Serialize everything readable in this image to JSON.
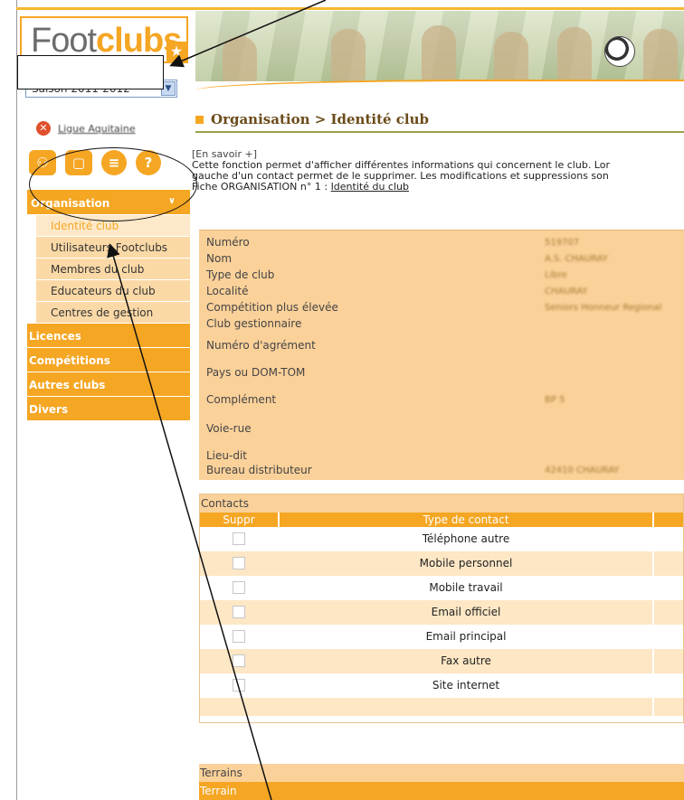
{
  "brand": {
    "foot": "Foot",
    "clubs": "clubs",
    "star_icon": "star-icon"
  },
  "season": {
    "selected": "Saison 2011-2012"
  },
  "logout": {
    "label": "Ligue Aquitaine"
  },
  "tool_icons": [
    "people-icon",
    "document-icon",
    "list-icon",
    "help-icon"
  ],
  "nav": {
    "organisation": "Organisation",
    "sub_items": [
      "Identité club",
      "Utilisateurs Footclubs",
      "Membres du club",
      "Educateurs du club",
      "Centres de gestion"
    ],
    "active_index": 0,
    "main_items": [
      "Licences",
      "Compétitions",
      "Autres clubs",
      "Divers"
    ]
  },
  "page": {
    "title": "Organisation > Identité club",
    "en_savoir": "[En savoir +]",
    "line1": "Cette fonction permet d'afficher différentes informations qui concernent le club. Lor",
    "line2": "gauche d'un contact permet de le supprimer. Les modifications et suppressions son",
    "line3_prefix": "Fiche ORGANISATION n° 1 : ",
    "line3_link": "Identité du club"
  },
  "identity": {
    "rows": [
      {
        "label": "Numéro",
        "value": "519707"
      },
      {
        "label": "Nom",
        "value": "A.S. CHAURAY"
      },
      {
        "label": "Type de club",
        "value": "Libre"
      },
      {
        "label": "Localité",
        "value": "CHAURAY"
      },
      {
        "label": "Compétition plus élevée",
        "value": "Seniors Honneur Regional"
      },
      {
        "label": "Club gestionnaire",
        "value": ""
      },
      {
        "label": "Numéro d'agrément",
        "value": ""
      },
      {
        "label": "Pays ou DOM-TOM",
        "value": ""
      },
      {
        "label": "Complément",
        "value": "BP 5"
      },
      {
        "label": "Voie-rue",
        "value": ""
      },
      {
        "label": "Lieu-dit",
        "value": ""
      },
      {
        "label": "Bureau distributeur",
        "value": "42410 CHAURAY"
      }
    ]
  },
  "contacts": {
    "header": "Contacts",
    "col_suppr": "Suppr",
    "col_type": "Type de contact",
    "rows": [
      "Téléphone autre",
      "Mobile personnel",
      "Mobile travail",
      "Email officiel",
      "Email principal",
      "Fax autre",
      "Site internet"
    ]
  },
  "terrains": {
    "header": "Terrains",
    "col": "Terrain"
  },
  "colors": {
    "accent": "#f5a623",
    "light": "#fbd19a",
    "pale": "#fde7c5"
  }
}
